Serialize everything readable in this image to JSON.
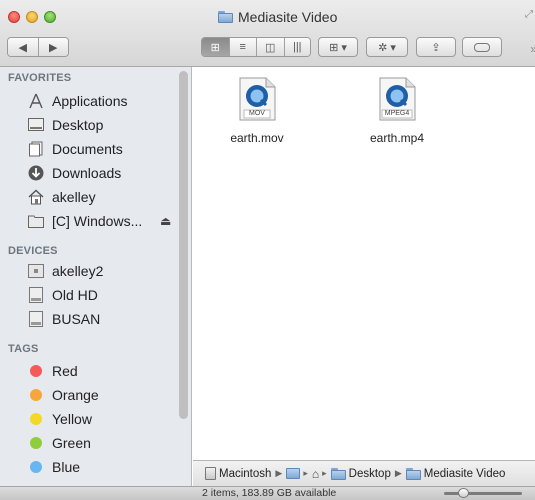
{
  "window": {
    "title": "Mediasite Video"
  },
  "toolbar": {
    "back_label": "◀",
    "forward_label": "▶",
    "view_icon_label": "⊞",
    "view_list_label": "≡",
    "view_column_label": "◫",
    "view_coverflow_label": "|||",
    "arrange_label": "⊞ ▾",
    "action_label": "✲ ▾",
    "share_label": "⇪"
  },
  "sidebar": {
    "favorites_header": "FAVORITES",
    "favorites": [
      {
        "label": "Applications",
        "icon": "applications-icon"
      },
      {
        "label": "Desktop",
        "icon": "desktop-icon"
      },
      {
        "label": "Documents",
        "icon": "documents-icon"
      },
      {
        "label": "Downloads",
        "icon": "downloads-icon"
      },
      {
        "label": "akelley",
        "icon": "home-icon"
      },
      {
        "label": "[C] Windows...",
        "icon": "folder-icon",
        "eject": "⏏"
      }
    ],
    "devices_header": "DEVICES",
    "devices": [
      {
        "label": "akelley2",
        "icon": "computer-icon"
      },
      {
        "label": "Old HD",
        "icon": "hard-drive-icon"
      },
      {
        "label": "BUSAN",
        "icon": "hard-drive-icon"
      }
    ],
    "tags_header": "TAGS",
    "tags": [
      {
        "label": "Red",
        "color": "#f45b57"
      },
      {
        "label": "Orange",
        "color": "#f7a73a"
      },
      {
        "label": "Yellow",
        "color": "#f3d829"
      },
      {
        "label": "Green",
        "color": "#8fcd3a"
      },
      {
        "label": "Blue",
        "color": "#66b6f2"
      }
    ]
  },
  "files": [
    {
      "name": "earth.mov",
      "badge": "MOV",
      "icon": "quicktime-movie-icon"
    },
    {
      "name": "earth.mp4",
      "badge": "MPEG4",
      "icon": "quicktime-movie-icon"
    }
  ],
  "pathbar": {
    "items": [
      "Macintosh",
      "",
      "",
      "Desktop",
      "Mediasite Video"
    ]
  },
  "status": {
    "text": "2 items, 183.89 GB available"
  }
}
